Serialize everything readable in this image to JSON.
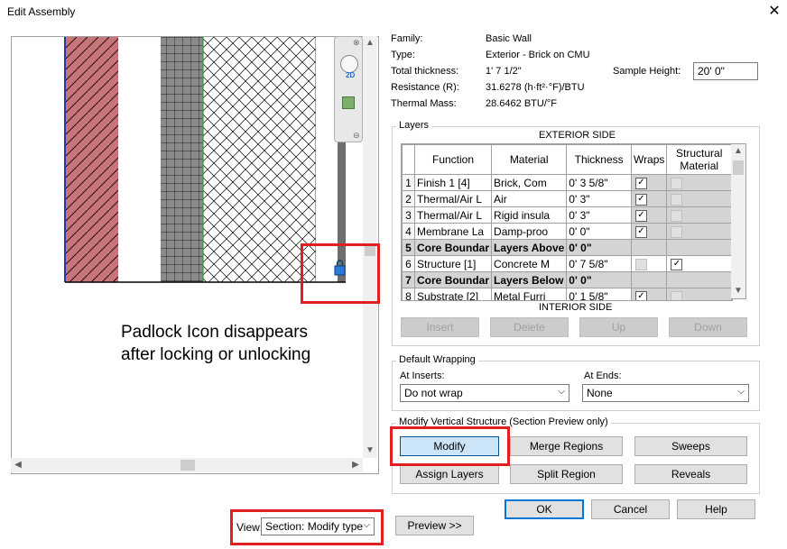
{
  "window": {
    "title": "Edit Assembly"
  },
  "properties": {
    "family_label": "Family:",
    "family_value": "Basic Wall",
    "type_label": "Type:",
    "type_value": "Exterior - Brick on CMU",
    "thickness_label": "Total thickness:",
    "thickness_value": "1'  7 1/2\"",
    "resistance_label": "Resistance (R):",
    "resistance_value": "31.6278 (h·ft²·°F)/BTU",
    "mass_label": "Thermal Mass:",
    "mass_value": "28.6462 BTU/°F",
    "sample_height_label": "Sample Height:",
    "sample_height_value": "20'  0\""
  },
  "layers": {
    "group_title": "Layers",
    "exterior_label": "EXTERIOR SIDE",
    "interior_label": "INTERIOR SIDE",
    "headers": {
      "function": "Function",
      "material": "Material",
      "thickness": "Thickness",
      "wraps": "Wraps",
      "structural": "Structural Material"
    },
    "rows": [
      {
        "num": "1",
        "function": "Finish 1 [4]",
        "material": "Brick, Com",
        "thickness": "0'  3 5/8\"",
        "wraps": true,
        "structural": false,
        "core": false
      },
      {
        "num": "2",
        "function": "Thermal/Air L",
        "material": "Air",
        "thickness": "0'  3\"",
        "wraps": true,
        "structural": false,
        "core": false
      },
      {
        "num": "3",
        "function": "Thermal/Air L",
        "material": "Rigid insula",
        "thickness": "0'  3\"",
        "wraps": true,
        "structural": false,
        "core": false
      },
      {
        "num": "4",
        "function": "Membrane La",
        "material": "Damp-proo",
        "thickness": "0'  0\"",
        "wraps": true,
        "structural": false,
        "core": false
      },
      {
        "num": "5",
        "function": "Core Boundar",
        "material": "Layers Above",
        "thickness": "0'  0\"",
        "core": true
      },
      {
        "num": "6",
        "function": "Structure [1]",
        "material": "Concrete M",
        "thickness": "0'  7 5/8\"",
        "wraps": false,
        "structural": true,
        "core": false
      },
      {
        "num": "7",
        "function": "Core Boundar",
        "material": "Layers Below",
        "thickness": "0'  0\"",
        "core": true
      },
      {
        "num": "8",
        "function": "Substrate [2]",
        "material": "Metal Furri",
        "thickness": "0'  1 5/8\"",
        "wraps": true,
        "structural": false,
        "core": false
      }
    ],
    "buttons": {
      "insert": "Insert",
      "delete": "Delete",
      "up": "Up",
      "down": "Down"
    }
  },
  "wrapping": {
    "group_title": "Default Wrapping",
    "inserts_label": "At Inserts:",
    "inserts_value": "Do not wrap",
    "ends_label": "At Ends:",
    "ends_value": "None"
  },
  "vertical": {
    "group_title": "Modify Vertical Structure (Section Preview only)",
    "modify": "Modify",
    "merge": "Merge Regions",
    "sweeps": "Sweeps",
    "assign": "Assign Layers",
    "split": "Split Region",
    "reveals": "Reveals"
  },
  "footer": {
    "ok": "OK",
    "cancel": "Cancel",
    "help": "Help",
    "view_label": "View:",
    "view_value": "Section: Modify type",
    "preview": "Preview >>"
  },
  "annotation": {
    "line1": "Padlock Icon disappears",
    "line2": "after locking or unlocking"
  },
  "nav": {
    "label_2d": "2D"
  },
  "colors": {
    "brick": "#c8757a",
    "cmu": "#7f7f7f",
    "insulation_border": "#1f9e3a",
    "highlight_red": "#e02020"
  }
}
